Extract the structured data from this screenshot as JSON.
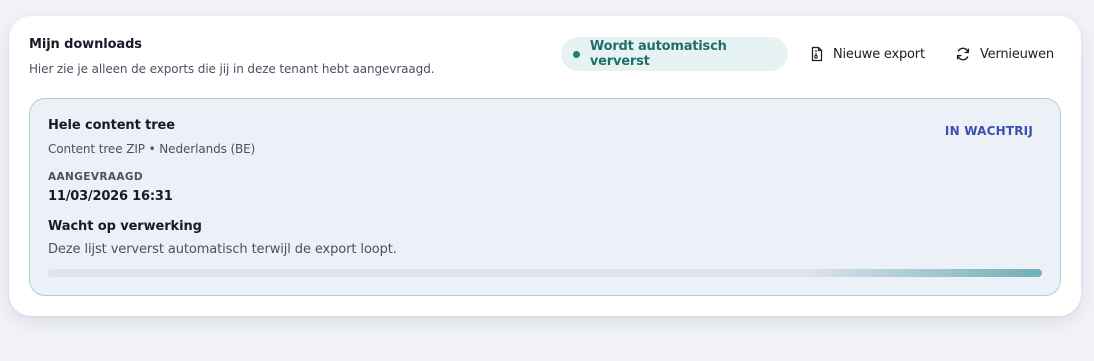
{
  "header": {
    "title": "Mijn downloads",
    "subtitle": "Hier zie je alleen de exports die jij in deze tenant hebt aangevraagd."
  },
  "toolbar": {
    "auto_refresh_label": "Wordt automatisch ververst",
    "new_export_label": "Nieuwe export",
    "refresh_label": "Vernieuwen"
  },
  "job": {
    "title": "Hele content tree",
    "meta": "Content tree ZIP • Nederlands (BE)",
    "status": "IN WACHTRIJ",
    "requested_label": "AANGEVRAAGD",
    "requested_value": "11/03/2026 16:31",
    "wait_title": "Wacht op verwerking",
    "wait_description": "Deze lijst ververst automatisch terwijl de export loopt."
  },
  "colors": {
    "accent_teal": "#1f6f6d",
    "status_blue": "#3a4fb2",
    "job_border": "#a9d4d2",
    "job_background": "#ecf0f7"
  },
  "icons": {
    "new_export": "file-zip-icon",
    "refresh": "refresh-icon",
    "auto_refresh": "status-dot-icon"
  }
}
